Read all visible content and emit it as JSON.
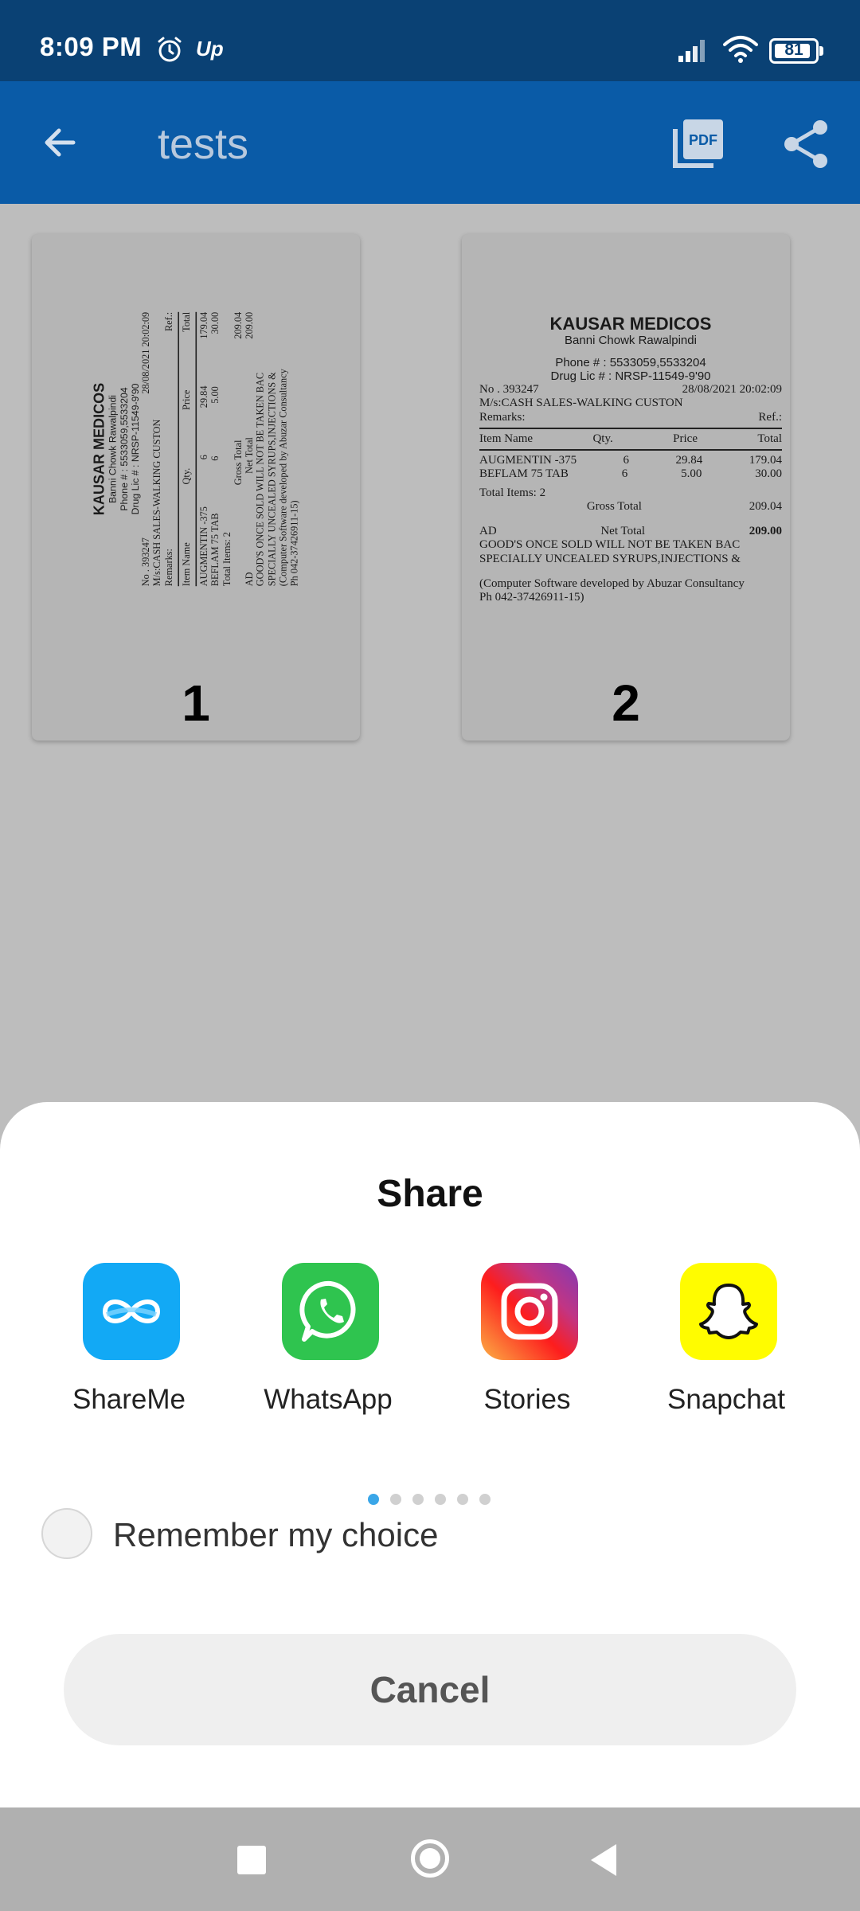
{
  "status_bar": {
    "time": "8:09 PM",
    "carrier_badge": "Up",
    "battery_level": "81"
  },
  "app_bar": {
    "title": "tests",
    "back_icon": "arrow-back-icon",
    "pdf_icon": "pdf-icon",
    "share_icon": "share-icon",
    "color": "#0a5ba7"
  },
  "pages": [
    {
      "number": "1",
      "orientation": "rotated",
      "receipt": {
        "shop": "KAUSAR MEDICOS",
        "address": "Banni Chowk Rawalpindi",
        "phone": "Phone # : 5533059,5533204",
        "drug_lic": "Drug Lic # : NRSP-11549-9'90",
        "no": "No . 393247",
        "date": "28/08/2021 20:02:09",
        "ms": "M/s:CASH SALES-WALKING CUSTON",
        "remarks": "Remarks:",
        "ref": "Ref.:",
        "col_item": "Item Name",
        "col_qty": "Qty.",
        "col_price": "Price",
        "col_total": "Total",
        "rows": [
          {
            "item": "AUGMENTIN -375",
            "qty": "6",
            "price": "29.84",
            "total": "179.04"
          },
          {
            "item": "BEFLAM 75 TAB",
            "qty": "6",
            "price": "5.00",
            "total": "30.00"
          }
        ],
        "total_items": "Total Items: 2",
        "gross_total_label": "Gross Total",
        "gross_total": "209.04",
        "ad": "AD",
        "net_total_label": "Net Total",
        "net_total": "209.00",
        "note_1": "GOOD'S ONCE SOLD WILL NOT BE TAKEN BAC",
        "note_2": "SPECIALLY UNCEALED SYRUPS,INJECTIONS &",
        "footer_1": "(Computer Software developed by Abuzar Consultancy",
        "footer_2": "Ph 042-37426911-15)"
      }
    },
    {
      "number": "2",
      "orientation": "upright",
      "receipt": {
        "shop": "KAUSAR MEDICOS",
        "address": "Banni Chowk Rawalpindi",
        "phone": "Phone # : 5533059,5533204",
        "drug_lic": "Drug Lic # : NRSP-11549-9'90",
        "no": "No . 393247",
        "date": "28/08/2021 20:02:09",
        "ms": "M/s:CASH SALES-WALKING CUSTON",
        "remarks": "Remarks:",
        "ref": "Ref.:",
        "col_item": "Item Name",
        "col_qty": "Qty.",
        "col_price": "Price",
        "col_total": "Total",
        "rows": [
          {
            "item": "AUGMENTIN -375",
            "qty": "6",
            "price": "29.84",
            "total": "179.04"
          },
          {
            "item": "BEFLAM 75 TAB",
            "qty": "6",
            "price": "5.00",
            "total": "30.00"
          }
        ],
        "total_items": "Total Items: 2",
        "gross_total_label": "Gross Total",
        "gross_total": "209.04",
        "ad": "AD",
        "net_total_label": "Net Total",
        "net_total": "209.00",
        "note_1": "GOOD'S ONCE SOLD WILL NOT BE TAKEN BAC",
        "note_2": "SPECIALLY UNCEALED SYRUPS,INJECTIONS &",
        "footer_1": "(Computer Software developed by Abuzar Consultancy",
        "footer_2": "Ph 042-37426911-15)"
      }
    }
  ],
  "share_sheet": {
    "title": "Share",
    "targets": [
      {
        "label": "ShareMe",
        "icon": "shareme-icon",
        "color": "#12a9f5"
      },
      {
        "label": "WhatsApp",
        "icon": "whatsapp-icon",
        "color": "#2fc44f"
      },
      {
        "label": "Stories",
        "icon": "instagram-icon",
        "color": "#e1306c"
      },
      {
        "label": "Snapchat",
        "icon": "snapchat-icon",
        "color": "#fffc00"
      }
    ],
    "pager": {
      "count": 6,
      "active_index": 0,
      "active_color": "#3aa6e8"
    },
    "remember_label": "Remember my choice",
    "remember_checked": false,
    "cancel_label": "Cancel"
  },
  "nav_bar": {
    "recents_icon": "square-recents-icon",
    "home_icon": "circle-home-icon",
    "back_icon": "triangle-back-icon"
  }
}
